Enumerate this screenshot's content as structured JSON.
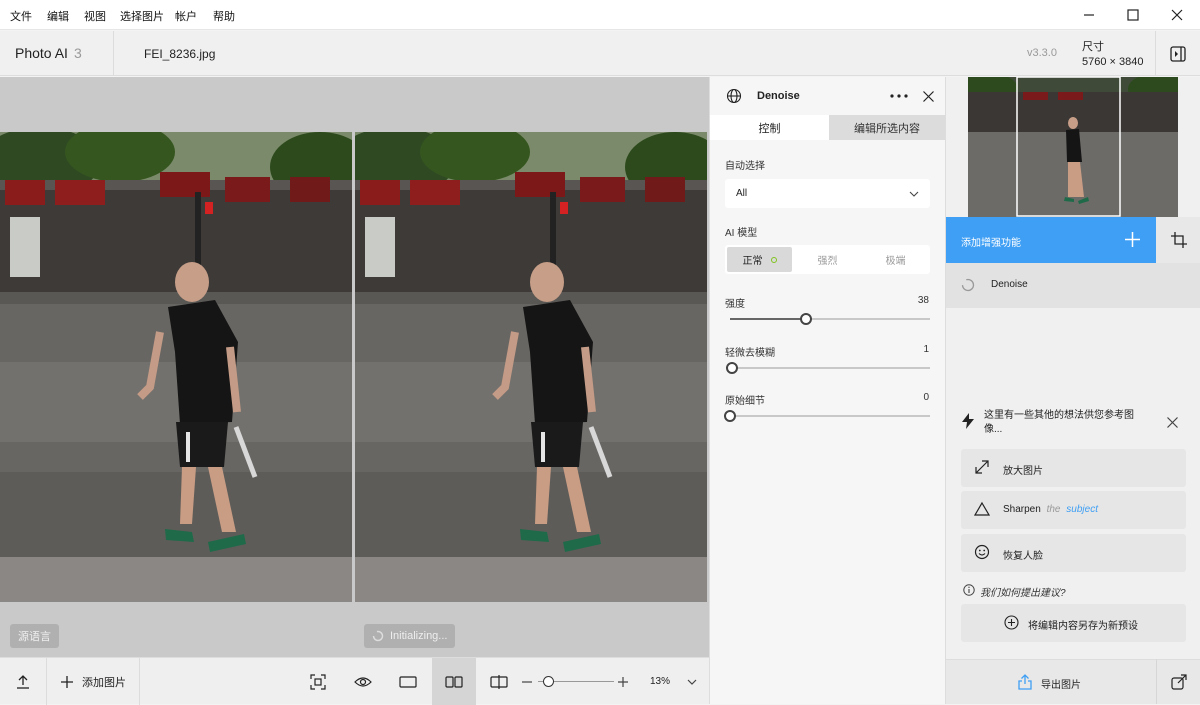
{
  "menu": [
    "文件",
    "编辑",
    "视图",
    "选择图片",
    "帐户",
    "帮助"
  ],
  "header": {
    "app_name": "Photo AI",
    "app_version_num": "3",
    "filename": "FEI_8236.jpg",
    "version": "v3.3.0",
    "size_label": "尺寸",
    "size_value": "5760 × 3840"
  },
  "canvas": {
    "left_tag": "源语言",
    "right_tag": "Initializing..."
  },
  "bottombar": {
    "add_image": "添加图片",
    "zoom": "13%",
    "zoom_fraction": 0.13
  },
  "panel": {
    "title": "Denoise",
    "tabs": [
      "控制",
      "编辑所选内容"
    ],
    "auto_select_label": "自动选择",
    "auto_select_value": "All",
    "model_label": "AI 模型",
    "models": [
      "正常",
      "强烈",
      "极端"
    ],
    "selected_model": "正常",
    "sliders": [
      {
        "label": "强度",
        "value": "38",
        "fraction": 0.38
      },
      {
        "label": "轻微去模糊",
        "value": "1",
        "fraction": 0.01
      },
      {
        "label": "原始细节",
        "value": "0",
        "fraction": 0.0
      }
    ]
  },
  "rightbar": {
    "add_enhance": "添加增强功能",
    "denoise_item": "Denoise",
    "suggestion_header": "这里有一些其他的想法供您参考图像...",
    "suggestions": [
      {
        "label": "放大图片",
        "icon": "upscale-icon"
      },
      {
        "label": "Sharpen",
        "suffix_plain": "the",
        "suffix_link": "subject",
        "icon": "sharpen-icon"
      },
      {
        "label": "恢复人脸",
        "icon": "face-recovery-icon"
      }
    ],
    "how_we_suggest": "我们如何提出建议?",
    "save_preset": "将编辑内容另存为新预设",
    "export": "导出图片"
  },
  "colors": {
    "accent": "#3f9ff4",
    "model_dot": "#7fc31c"
  }
}
